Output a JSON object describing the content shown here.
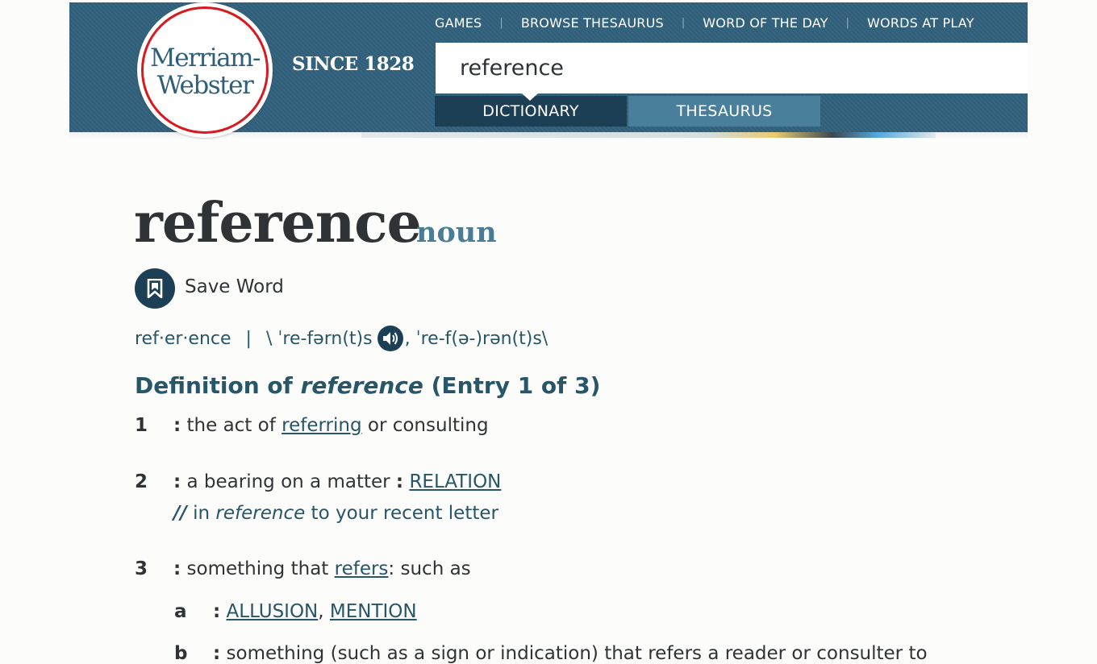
{
  "header": {
    "logo": {
      "line1": "Merriam-",
      "line2": "Webster"
    },
    "since": "SINCE 1828",
    "nav": [
      "GAMES",
      "BROWSE THESAURUS",
      "WORD OF THE DAY",
      "WORDS AT PLAY"
    ],
    "search_value": "reference",
    "tabs": {
      "dictionary": "DICTIONARY",
      "thesaurus": "THESAURUS"
    },
    "colors": {
      "brand": "#305f7a",
      "active_tab": "#1d3f56",
      "inactive_tab": "#4a7f9c",
      "logo_ring": "#d71920"
    }
  },
  "entry": {
    "headword": "reference",
    "part_of_speech": "noun",
    "save_label": "Save Word",
    "syllables": "ref·er·ence",
    "pron_separator": "|",
    "pron1": "\\ ˈre-fərn(t)s",
    "pron2": ", ˈre-f(ə-)rən(t)s\\",
    "definition_heading": {
      "prefix": "Definition of ",
      "word": "reference",
      "suffix": " (Entry 1 of 3)"
    },
    "senses": [
      {
        "num": "1",
        "colon": ":",
        "text_before": " the act of ",
        "link": "referring",
        "text_after": " or consulting"
      },
      {
        "num": "2",
        "colon": ":",
        "text_before": " a bearing on a matter ",
        "colon2": ":",
        "link": "RELATION",
        "example": {
          "slash": "//",
          "before": " in ",
          "word": "reference",
          "after": " to your recent letter"
        }
      },
      {
        "num": "3",
        "colon": ":",
        "text_before": " something that ",
        "link": "refers",
        "text_after": ": such as",
        "subsenses": [
          {
            "letter": "a",
            "colon": ":",
            "link1": "ALLUSION",
            "sep": ",",
            "link2": "MENTION"
          },
          {
            "letter": "b",
            "colon": ":",
            "text": " something (such as a sign or indication) that refers a reader or consulter to"
          }
        ]
      }
    ]
  }
}
